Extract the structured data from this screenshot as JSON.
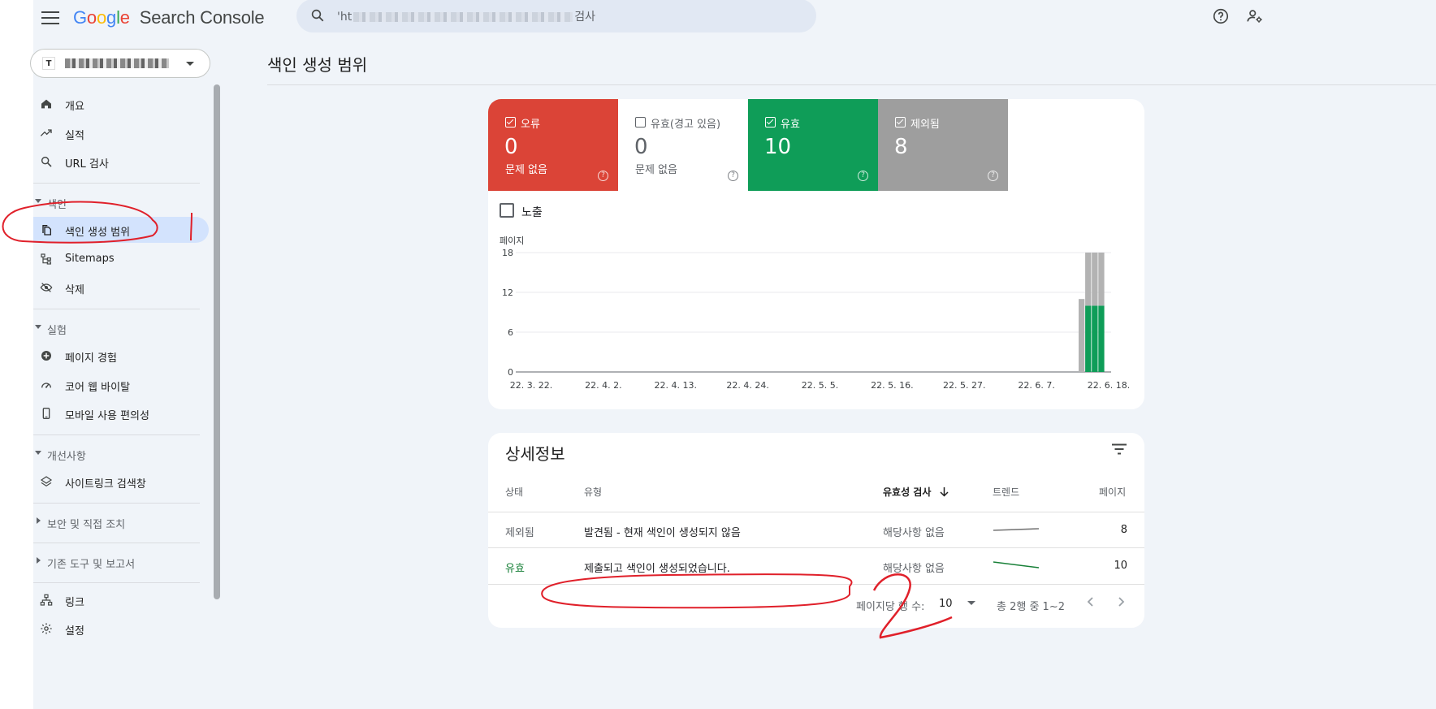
{
  "header": {
    "logo": {
      "g1": "G",
      "o1": "o",
      "o2": "o",
      "g2": "g",
      "l": "l",
      "e": "e",
      "product": "Search Console"
    },
    "search": {
      "prefix": "'ht",
      "suffix": "검사"
    }
  },
  "property": {
    "icon_text": "T"
  },
  "sidebar": {
    "items_top": [
      {
        "label": "개요",
        "icon": "home-icon"
      },
      {
        "label": "실적",
        "icon": "trending-up-icon"
      },
      {
        "label": "URL 검사",
        "icon": "search-icon"
      }
    ],
    "index_section": {
      "label": "색인",
      "items": [
        {
          "label": "색인 생성 범위",
          "icon": "file-copy-icon",
          "active": true
        },
        {
          "label": "Sitemaps",
          "icon": "sitemap-icon"
        },
        {
          "label": "삭제",
          "icon": "visibility-off-icon"
        }
      ]
    },
    "experience_section": {
      "label": "실험",
      "items": [
        {
          "label": "페이지 경험",
          "icon": "plus-circle-icon"
        },
        {
          "label": "코어 웹 바이탈",
          "icon": "speed-icon"
        },
        {
          "label": "모바일 사용 편의성",
          "icon": "smartphone-icon"
        }
      ]
    },
    "enhancements_section": {
      "label": "개선사항",
      "items": [
        {
          "label": "사이트링크 검색창",
          "icon": "layers-icon"
        }
      ]
    },
    "security_section": {
      "label": "보안 및 직접 조치"
    },
    "legacy_section": {
      "label": "기존 도구 및 보고서"
    },
    "items_bottom": [
      {
        "label": "링크",
        "icon": "links-icon"
      },
      {
        "label": "설정",
        "icon": "settings-icon"
      }
    ]
  },
  "main": {
    "title": "색인 생성 범위",
    "tiles": [
      {
        "label": "오류",
        "value": "0",
        "sub": "문제 없음",
        "checked": true,
        "bg": "#db4437",
        "fg": "#ffffff"
      },
      {
        "label": "유효(경고 있음)",
        "value": "0",
        "sub": "문제 없음",
        "checked": false,
        "bg": "#ffffff",
        "fg": "#5f6368"
      },
      {
        "label": "유효",
        "value": "10",
        "sub": "",
        "checked": true,
        "bg": "#0f9d58",
        "fg": "#ffffff"
      },
      {
        "label": "제외됨",
        "value": "8",
        "sub": "",
        "checked": true,
        "bg": "#9e9e9e",
        "fg": "#ffffff"
      }
    ],
    "help_glyph": "?",
    "impressions_label": "노출"
  },
  "chart_data": {
    "type": "bar",
    "stacked": true,
    "ylabel": "페이지",
    "ylim": [
      0,
      18
    ],
    "yticks": [
      "18",
      "12",
      "6",
      "0"
    ],
    "xticks": [
      "22. 3. 22.",
      "22. 4. 2.",
      "22. 4. 13.",
      "22. 4. 24.",
      "22. 5. 5.",
      "22. 5. 16.",
      "22. 5. 27.",
      "22. 6. 7.",
      "22. 6. 18."
    ],
    "grid": true,
    "categories": [
      "22. 6. 15.",
      "22. 6. 16.",
      "22. 6. 17.",
      "22. 6. 18."
    ],
    "series": [
      {
        "name": "유효",
        "color": "#0f9d58",
        "values": [
          0,
          10,
          10,
          10
        ]
      },
      {
        "name": "제외됨",
        "color": "#b3b3b3",
        "values": [
          11,
          8,
          8,
          8
        ]
      }
    ]
  },
  "details": {
    "title": "상세정보",
    "columns": {
      "status": "상태",
      "type": "유형",
      "validation": "유효성 검사",
      "trend": "트렌드",
      "pages": "페이지"
    },
    "rows": [
      {
        "status": "제외됨",
        "status_color": "#5f6368",
        "type": "발견됨 - 현재 색인이 생성되지 않음",
        "validation": "해당사항 없음",
        "trend": [
          0.4,
          0.6
        ],
        "trend_color": "#757575",
        "pages": "8"
      },
      {
        "status": "유효",
        "status_color": "#188038",
        "type": "제출되고 색인이 생성되었습니다.",
        "validation": "해당사항 없음",
        "trend": [
          0.9,
          0.2
        ],
        "trend_color": "#188038",
        "pages": "10"
      }
    ],
    "pager": {
      "rows_per_page_label": "페이지당 행 수:",
      "rows_per_page": "10",
      "range": "총 2행 중 1~2"
    }
  },
  "annotations": {
    "mark1": "1",
    "mark2": "2"
  }
}
